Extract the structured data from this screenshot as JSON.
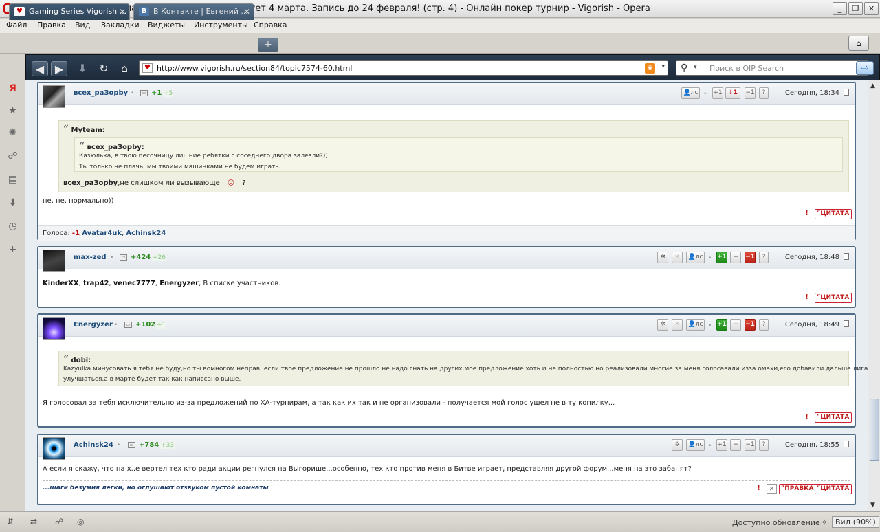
{
  "window": {
    "title": "Gaming Series Vigorish на PartyPoker. Серия стартует 4 марта. Запись до 24 февраля! (стр. 4) - Онлайн покер турнир - Vigorish - Opera",
    "minimize": "_",
    "restore": "❐",
    "close": "✕"
  },
  "menu": [
    "Файл",
    "Правка",
    "Вид",
    "Закладки",
    "Виджеты",
    "Инструменты",
    "Справка"
  ],
  "tabs": [
    {
      "label": "Gaming Series Vigorish ...",
      "favicon": "♥",
      "active": true
    },
    {
      "label": "В Контакте | Евгений ...",
      "favicon": "B",
      "active": false
    }
  ],
  "address": {
    "url": "http://www.vigorish.ru/section84/topic7574-60.html",
    "search_placeholder": "Поиск в QIP Search"
  },
  "posts": [
    {
      "user": "всех_раЗорbу",
      "rep": "+1",
      "rep_small": "+5",
      "date": "Сегодня, 18:34",
      "quote_outer_author": "Myteam:",
      "quote_inner_author": "всех_раЗорbу:",
      "quote_inner_lines": [
        "Казюлька, в твою песочницу лишние ребятки с соседнего двора залезли?))",
        "Ты только не плачь, мы твоими машинками не будем играть."
      ],
      "quote_outer_author_ref": "всех_раЗорbу",
      "quote_outer_text": ",не слишком ли вызывающе",
      "quote_outer_tail": "?",
      "text": "не, не, нормально))",
      "votes_label": "Голоса:",
      "votes_value": "-1",
      "votes_users": [
        "Avatar4uk",
        "Achinsk24"
      ],
      "buttons": {
        "ls": "лс",
        "plus": "+1",
        "minus_count": "↓1",
        "minus": "−1",
        "help": "?"
      }
    },
    {
      "user": "max-zed",
      "rep": "+424",
      "rep_small": "+26",
      "date": "Сегодня, 18:48",
      "text_bold": [
        "KinderXX",
        "trap42",
        "venec7777",
        "Energyzer"
      ],
      "text_tail": "В списке участников.",
      "buttons": {
        "ls": "лс",
        "plus": "+1",
        "mid": "−",
        "minus": "−1",
        "help": "?"
      }
    },
    {
      "user": "Energyzer",
      "rep": "+102",
      "rep_small": "+1",
      "date": "Сегодня, 18:49",
      "quote_author": "dobi:",
      "quote_lines": [
        "Kazyulka минусовать я тебя не буду,но ты вомногом неправ. если твое предложение не прошло не надо гнать на других.мое предложение хоть и не полностью но реализовали.многие за меня голосавали изза омахи,его добавили.дальше лига будет",
        "улучшаться,а в марте будет так как написсано выше."
      ],
      "text": "Я голосовал за тебя исключительно из-за предложений по ХА-турнирам, а так как их так и не организовали - получается мой голос ушел не в ту копилку...",
      "buttons": {
        "ls": "лс",
        "plus": "+1",
        "mid": "−",
        "minus": "−1",
        "help": "?"
      }
    },
    {
      "user": "Achinsk24",
      "rep": "+784",
      "rep_small": "+33",
      "date": "Сегодня, 18:55",
      "text": "А если я скажу, что на х..е вертел тех кто ради акции регнулся на Выгорише...особенно, тех кто против меня в Битве играет, представляя другой форум...меня на это забанят?",
      "signature": "...шаги безумия легки, но оглушают отзвуком пустой комнаты",
      "buttons": {
        "ls": "лс",
        "plus": "+1",
        "mid": "−",
        "minus": "−1",
        "help": "?"
      }
    }
  ],
  "post_actions": {
    "warn": "!",
    "quote": "ЦИТАТА",
    "edit": "ПРАВКА",
    "delete": "✕"
  },
  "status": {
    "update": "Доступно обновление",
    "zoom": "Вид (90%)"
  },
  "colors": {
    "accent": "#4f6b86",
    "positive": "#2a8a1e",
    "negative": "#c01010"
  }
}
